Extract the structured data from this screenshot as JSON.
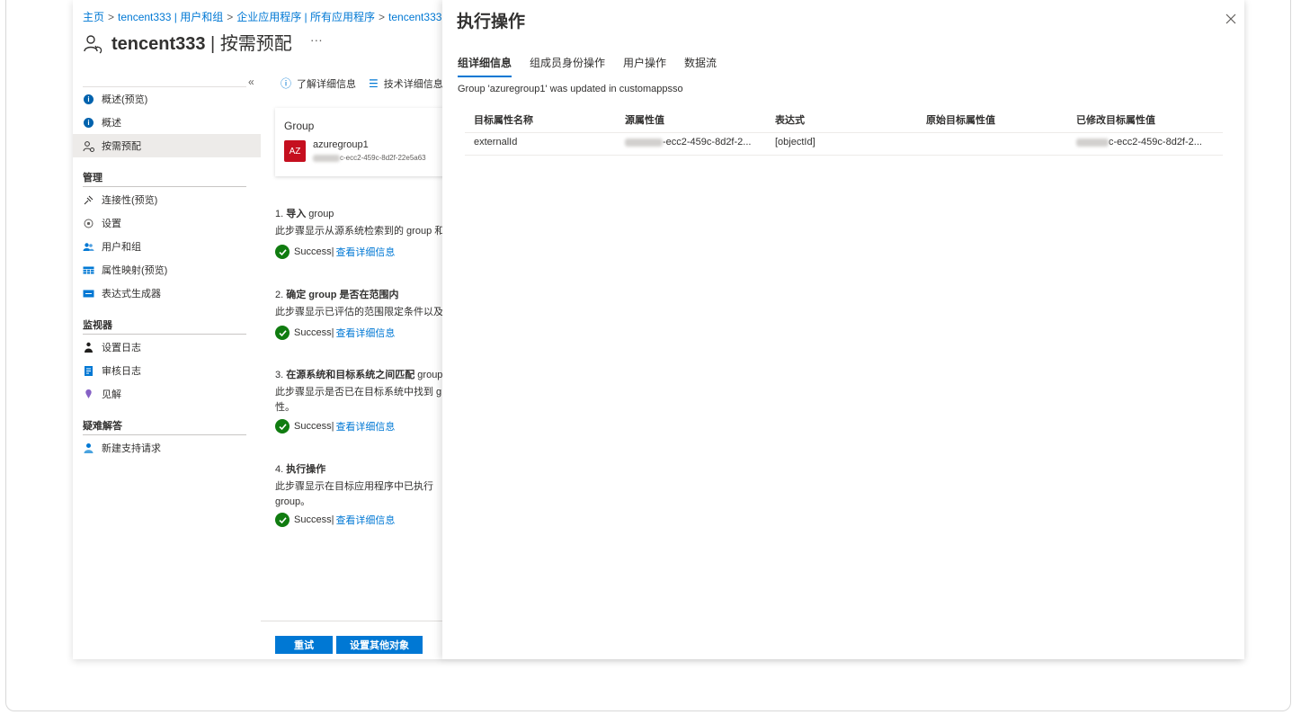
{
  "breadcrumb": {
    "items": [
      "主页",
      "tencent333 | 用户和组",
      "企业应用程序 | 所有应用程序",
      "tencent333"
    ],
    "separator": ">"
  },
  "header": {
    "title_app": "tencent333",
    "title_sep": " | ",
    "title_page": "按需预配",
    "more": "···"
  },
  "sidebar": {
    "collapse": "«",
    "top_items": [
      {
        "label": "概述(预览)",
        "icon": "info-icon"
      },
      {
        "label": "概述",
        "icon": "info-icon"
      },
      {
        "label": "按需预配",
        "icon": "user-sync-icon",
        "active": true
      }
    ],
    "sections": [
      {
        "heading": "管理",
        "items": [
          {
            "label": "连接性(预览)",
            "icon": "plug-icon"
          },
          {
            "label": "设置",
            "icon": "gear-icon"
          },
          {
            "label": "用户和组",
            "icon": "users-icon"
          },
          {
            "label": "属性映射(预览)",
            "icon": "table-icon"
          },
          {
            "label": "表达式生成器",
            "icon": "expression-icon"
          }
        ]
      },
      {
        "heading": "监视器",
        "items": [
          {
            "label": "设置日志",
            "icon": "log-icon"
          },
          {
            "label": "审核日志",
            "icon": "audit-icon"
          },
          {
            "label": "见解",
            "icon": "insights-icon"
          }
        ]
      },
      {
        "heading": "疑难解答",
        "items": [
          {
            "label": "新建支持请求",
            "icon": "support-icon"
          }
        ]
      }
    ]
  },
  "toolbar": {
    "learn_more": "了解详细信息",
    "tech_details": "技术详细信息"
  },
  "group_card": {
    "title": "Group",
    "avatar": "AZ",
    "name": "azuregroup1",
    "id_visible": "c-ecc2-459c-8d2f-22e5a63"
  },
  "steps": [
    {
      "title_num": "1. ",
      "title_bold": "导入",
      "title_rest": " group",
      "desc": [
        "此步骤显示从源系统检索到的 group 和源"
      ],
      "status": "Success|",
      "link": "查看详细信息"
    },
    {
      "title_num": "2. ",
      "title_bold": "确定",
      "title_rest": " group 是否在范围内",
      "desc": [
        "此步骤显示已评估的范围限定条件以及 g"
      ],
      "status": "Success|",
      "link": "查看详细信息"
    },
    {
      "title_num": "3. ",
      "title_bold": "在源系统和目标系统之间匹配",
      "title_rest": " group",
      "desc": [
        "此步骤显示是否已在目标系统中找到 g",
        "性。"
      ],
      "status": "Success|",
      "link": "查看详细信息"
    },
    {
      "title_num": "4. ",
      "title_bold": "执行操作",
      "title_rest": "",
      "desc": [
        "此步骤显示在目标应用程序中已执行",
        "group。"
      ],
      "status": "Success|",
      "link": "查看详细信息"
    }
  ],
  "buttons": {
    "retry": "重试",
    "provision_other": "设置其他对象"
  },
  "panel": {
    "title": "执行操作",
    "tabs": [
      "组详细信息",
      "组成员身份操作",
      "用户操作",
      "数据流"
    ],
    "active_tab": 0,
    "message": "Group 'azuregroup1' was updated in customappsso",
    "table": {
      "headers": [
        "目标属性名称",
        "源属性值",
        "表达式",
        "原始目标属性值",
        "已修改目标属性值"
      ],
      "rows": [
        {
          "target_attr": "externalId",
          "source_value": "-ecc2-459c-8d2f-2...",
          "expression": "[objectId]",
          "original_value": "",
          "modified_value": "c-ecc2-459c-8d2f-2..."
        }
      ]
    }
  },
  "colors": {
    "accent": "#0078d4",
    "success": "#107c10",
    "avatar_red": "#c50f1f"
  }
}
